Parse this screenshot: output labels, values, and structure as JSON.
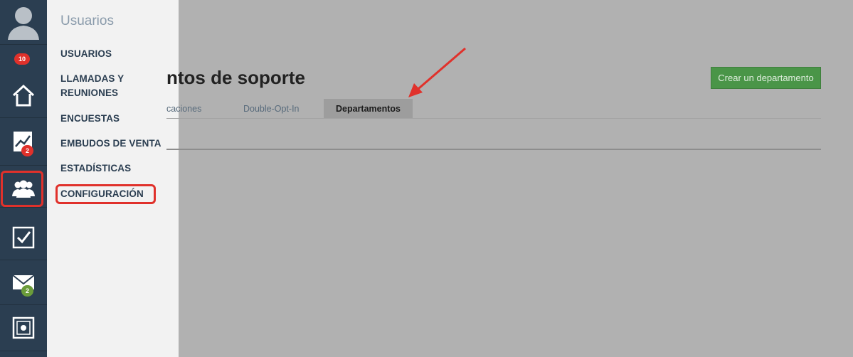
{
  "rail": {
    "notification_badge": "10",
    "stats_badge": "2",
    "mail_badge": "2"
  },
  "flyout": {
    "title": "Usuarios",
    "items": [
      {
        "label": "USUARIOS"
      },
      {
        "label": "LLAMADAS Y\nREUNIONES"
      },
      {
        "label": "ENCUESTAS"
      },
      {
        "label": "EMBUDOS DE VENTA"
      },
      {
        "label": "ESTADÍSTICAS"
      },
      {
        "label": "CONFIGURACIÓN"
      }
    ]
  },
  "main": {
    "title": "ntos de soporte",
    "create_button": "Crear un departamento",
    "tabs": [
      {
        "label": "caciones"
      },
      {
        "label": "Double-Opt-In"
      },
      {
        "label": "Departamentos"
      }
    ]
  },
  "colors": {
    "overlay": "#b1b1b1",
    "rail": "#2b3e51",
    "highlight": "#e0312b",
    "primary_button": "#4a9548"
  }
}
